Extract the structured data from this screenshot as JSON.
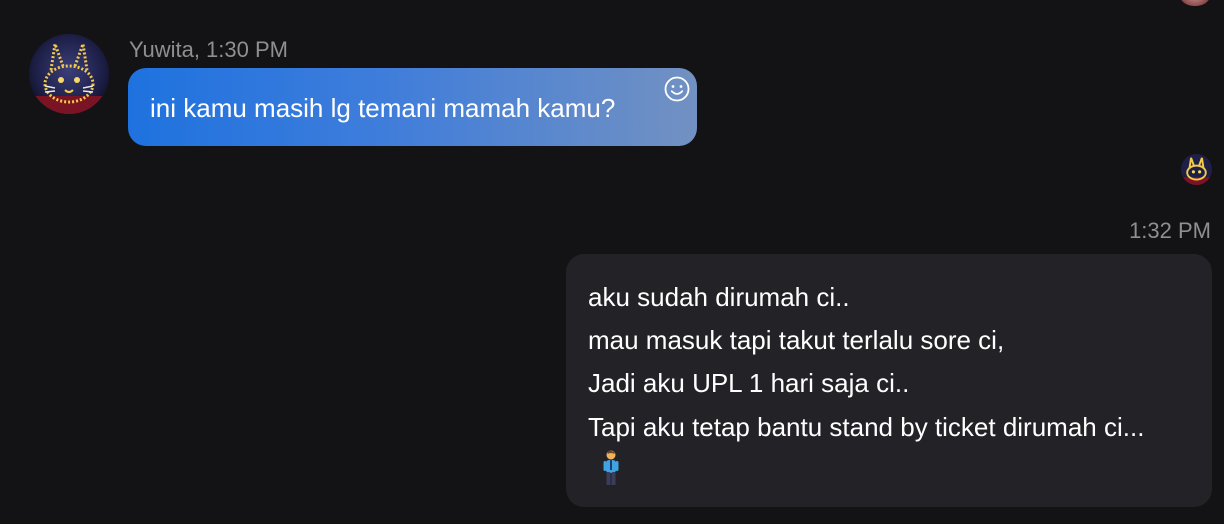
{
  "conversation": {
    "incoming": {
      "sender": "Yuwita",
      "time": "1:30 PM",
      "sender_line": "Yuwita, 1:30 PM",
      "text": "ini kamu masih lg temani mamah kamu?",
      "reaction_icon": "smiley-icon"
    },
    "outgoing": {
      "time": "1:32 PM",
      "lines": [
        "aku sudah dirumah ci..",
        "mau masuk tapi takut terlalu sore ci,",
        "Jadi aku UPL 1 hari saja ci..",
        "Tapi aku tetap bantu stand by ticket dirumah ci..."
      ],
      "emoji": "person-standing-emoji"
    }
  },
  "colors": {
    "background": "#131316",
    "incoming_bubble_start": "#1e72df",
    "incoming_bubble_end": "#7291c2",
    "outgoing_bubble": "#222227",
    "meta_text": "#8e8e93"
  }
}
